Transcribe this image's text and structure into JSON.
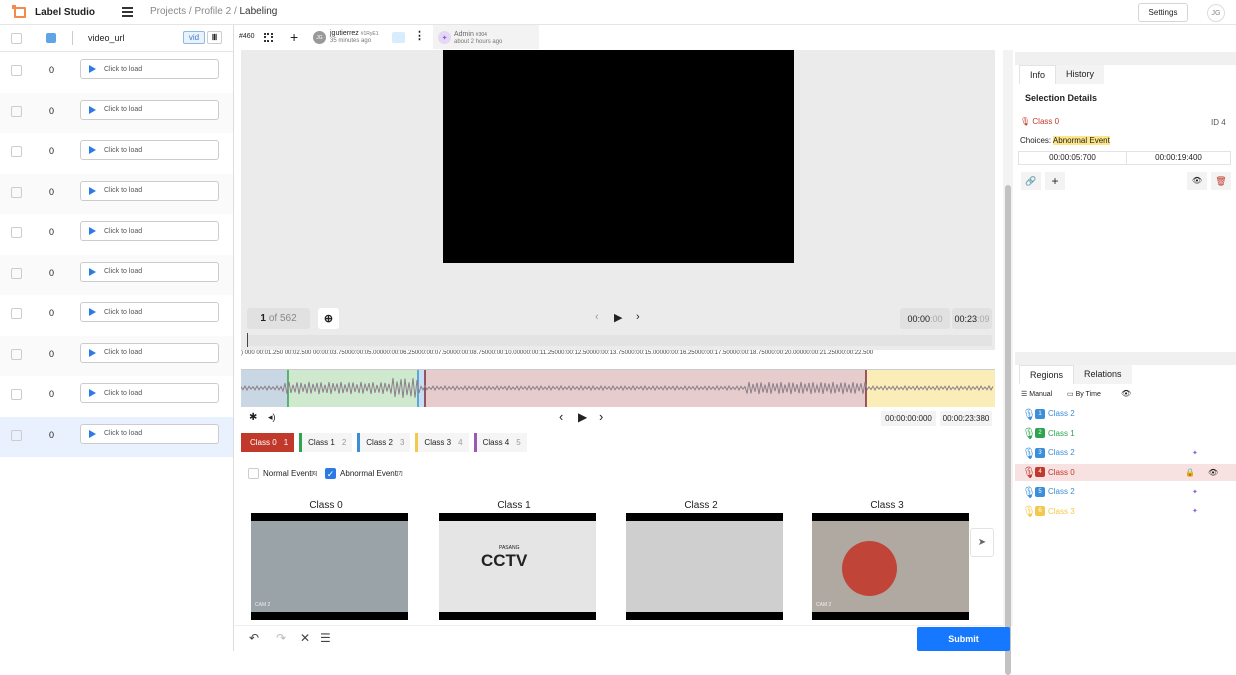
{
  "header": {
    "app_name": "Label Studio",
    "breadcrumb": [
      "Projects",
      "/",
      "Profile 2",
      "/",
      "Labeling"
    ],
    "settings_label": "Settings",
    "user_initials": "JG"
  },
  "table": {
    "column": "video_url",
    "tag": "vid",
    "rows": [
      {
        "value": "0",
        "link": "Click to load"
      },
      {
        "value": "0",
        "link": "Click to load"
      },
      {
        "value": "0",
        "link": "Click to load"
      },
      {
        "value": "0",
        "link": "Click to load"
      },
      {
        "value": "0",
        "link": "Click to load"
      },
      {
        "value": "0",
        "link": "Click to load"
      },
      {
        "value": "0",
        "link": "Click to load"
      },
      {
        "value": "0",
        "link": "Click to load"
      },
      {
        "value": "0",
        "link": "Click to load"
      },
      {
        "value": "0",
        "link": "Click to load"
      }
    ]
  },
  "annotation_header": {
    "task_id": "#460",
    "user1": {
      "initials": "JG",
      "name": "jgutierrez",
      "id": "#1RyE1",
      "time": "35 minutes ago"
    },
    "user2": {
      "name": "Admin",
      "id": "#304",
      "time": "about 2 hours ago"
    }
  },
  "video": {
    "frame_current": "1",
    "frame_total": "of 562",
    "time_current": "00:00",
    "time_current_dim": ":00",
    "time_total": "00:23",
    "time_total_dim": ":09"
  },
  "ruler": ") 000   00:01.250   00:02.500   00:00:03.75000:00:05.00000:00:06.25000:00:07.50000:00:08.75000:00:10.00000:00:11.25000:00:12.50000:00:13.75000:00:15.00000:00:16.25000:00:17.50000:00:18.75000:00:20.00000:00:21.25000:00:22.500",
  "audio": {
    "time_current": "00:00:00:000",
    "time_total": "00:00:23:380"
  },
  "labels": [
    {
      "name": "Class 0",
      "key": "1",
      "color": "#c0392b",
      "bg": "#c0392b",
      "fg": "#ffffff"
    },
    {
      "name": "Class 1",
      "key": "2",
      "color": "#2ea44f",
      "bg": "#ffffff",
      "fg": "#222222"
    },
    {
      "name": "Class 2",
      "key": "3",
      "color": "#3b8fd9",
      "bg": "#ffffff",
      "fg": "#222222"
    },
    {
      "name": "Class 3",
      "key": "4",
      "color": "#f2c94c",
      "bg": "#ffffff",
      "fg": "#222222"
    },
    {
      "name": "Class 4",
      "key": "5",
      "color": "#9b59b6",
      "bg": "#ffffff",
      "fg": "#222222"
    }
  ],
  "choices": {
    "normal": "Normal Event",
    "normal_sup": "[6]",
    "abnormal": "Abnormal Event",
    "abnormal_sup": "[7]"
  },
  "gallery": [
    {
      "title": "Class 0"
    },
    {
      "title": "Class 1"
    },
    {
      "title": "Class 2"
    },
    {
      "title": "Class 3"
    }
  ],
  "gallery_text": {
    "cctv": "CCTV",
    "cctv_small": "PASANG",
    "cam": "CAM 2"
  },
  "submit_label": "Submit",
  "info_panel": {
    "tab_info": "Info",
    "tab_history": "History",
    "title": "Selection Details",
    "region_label": "Class 0",
    "id_label": "ID 4",
    "choices_label": "Choices:",
    "choice_value": "Abnormal Event",
    "start": "00:00:05:700",
    "end": "00:00:19:400"
  },
  "regions_panel": {
    "tab_regions": "Regions",
    "tab_relations": "Relations",
    "sort_manual": "Manual",
    "sort_time": "By Time",
    "items": [
      {
        "n": "1",
        "name": "Class 2",
        "color": "#3b8fd9"
      },
      {
        "n": "2",
        "name": "Class 1",
        "color": "#2ea44f"
      },
      {
        "n": "3",
        "name": "Class 2",
        "color": "#3b8fd9"
      },
      {
        "n": "4",
        "name": "Class 0",
        "color": "#c0392b"
      },
      {
        "n": "5",
        "name": "Class 2",
        "color": "#3b8fd9"
      },
      {
        "n": "6",
        "name": "Class 3",
        "color": "#f2c94c"
      }
    ]
  }
}
